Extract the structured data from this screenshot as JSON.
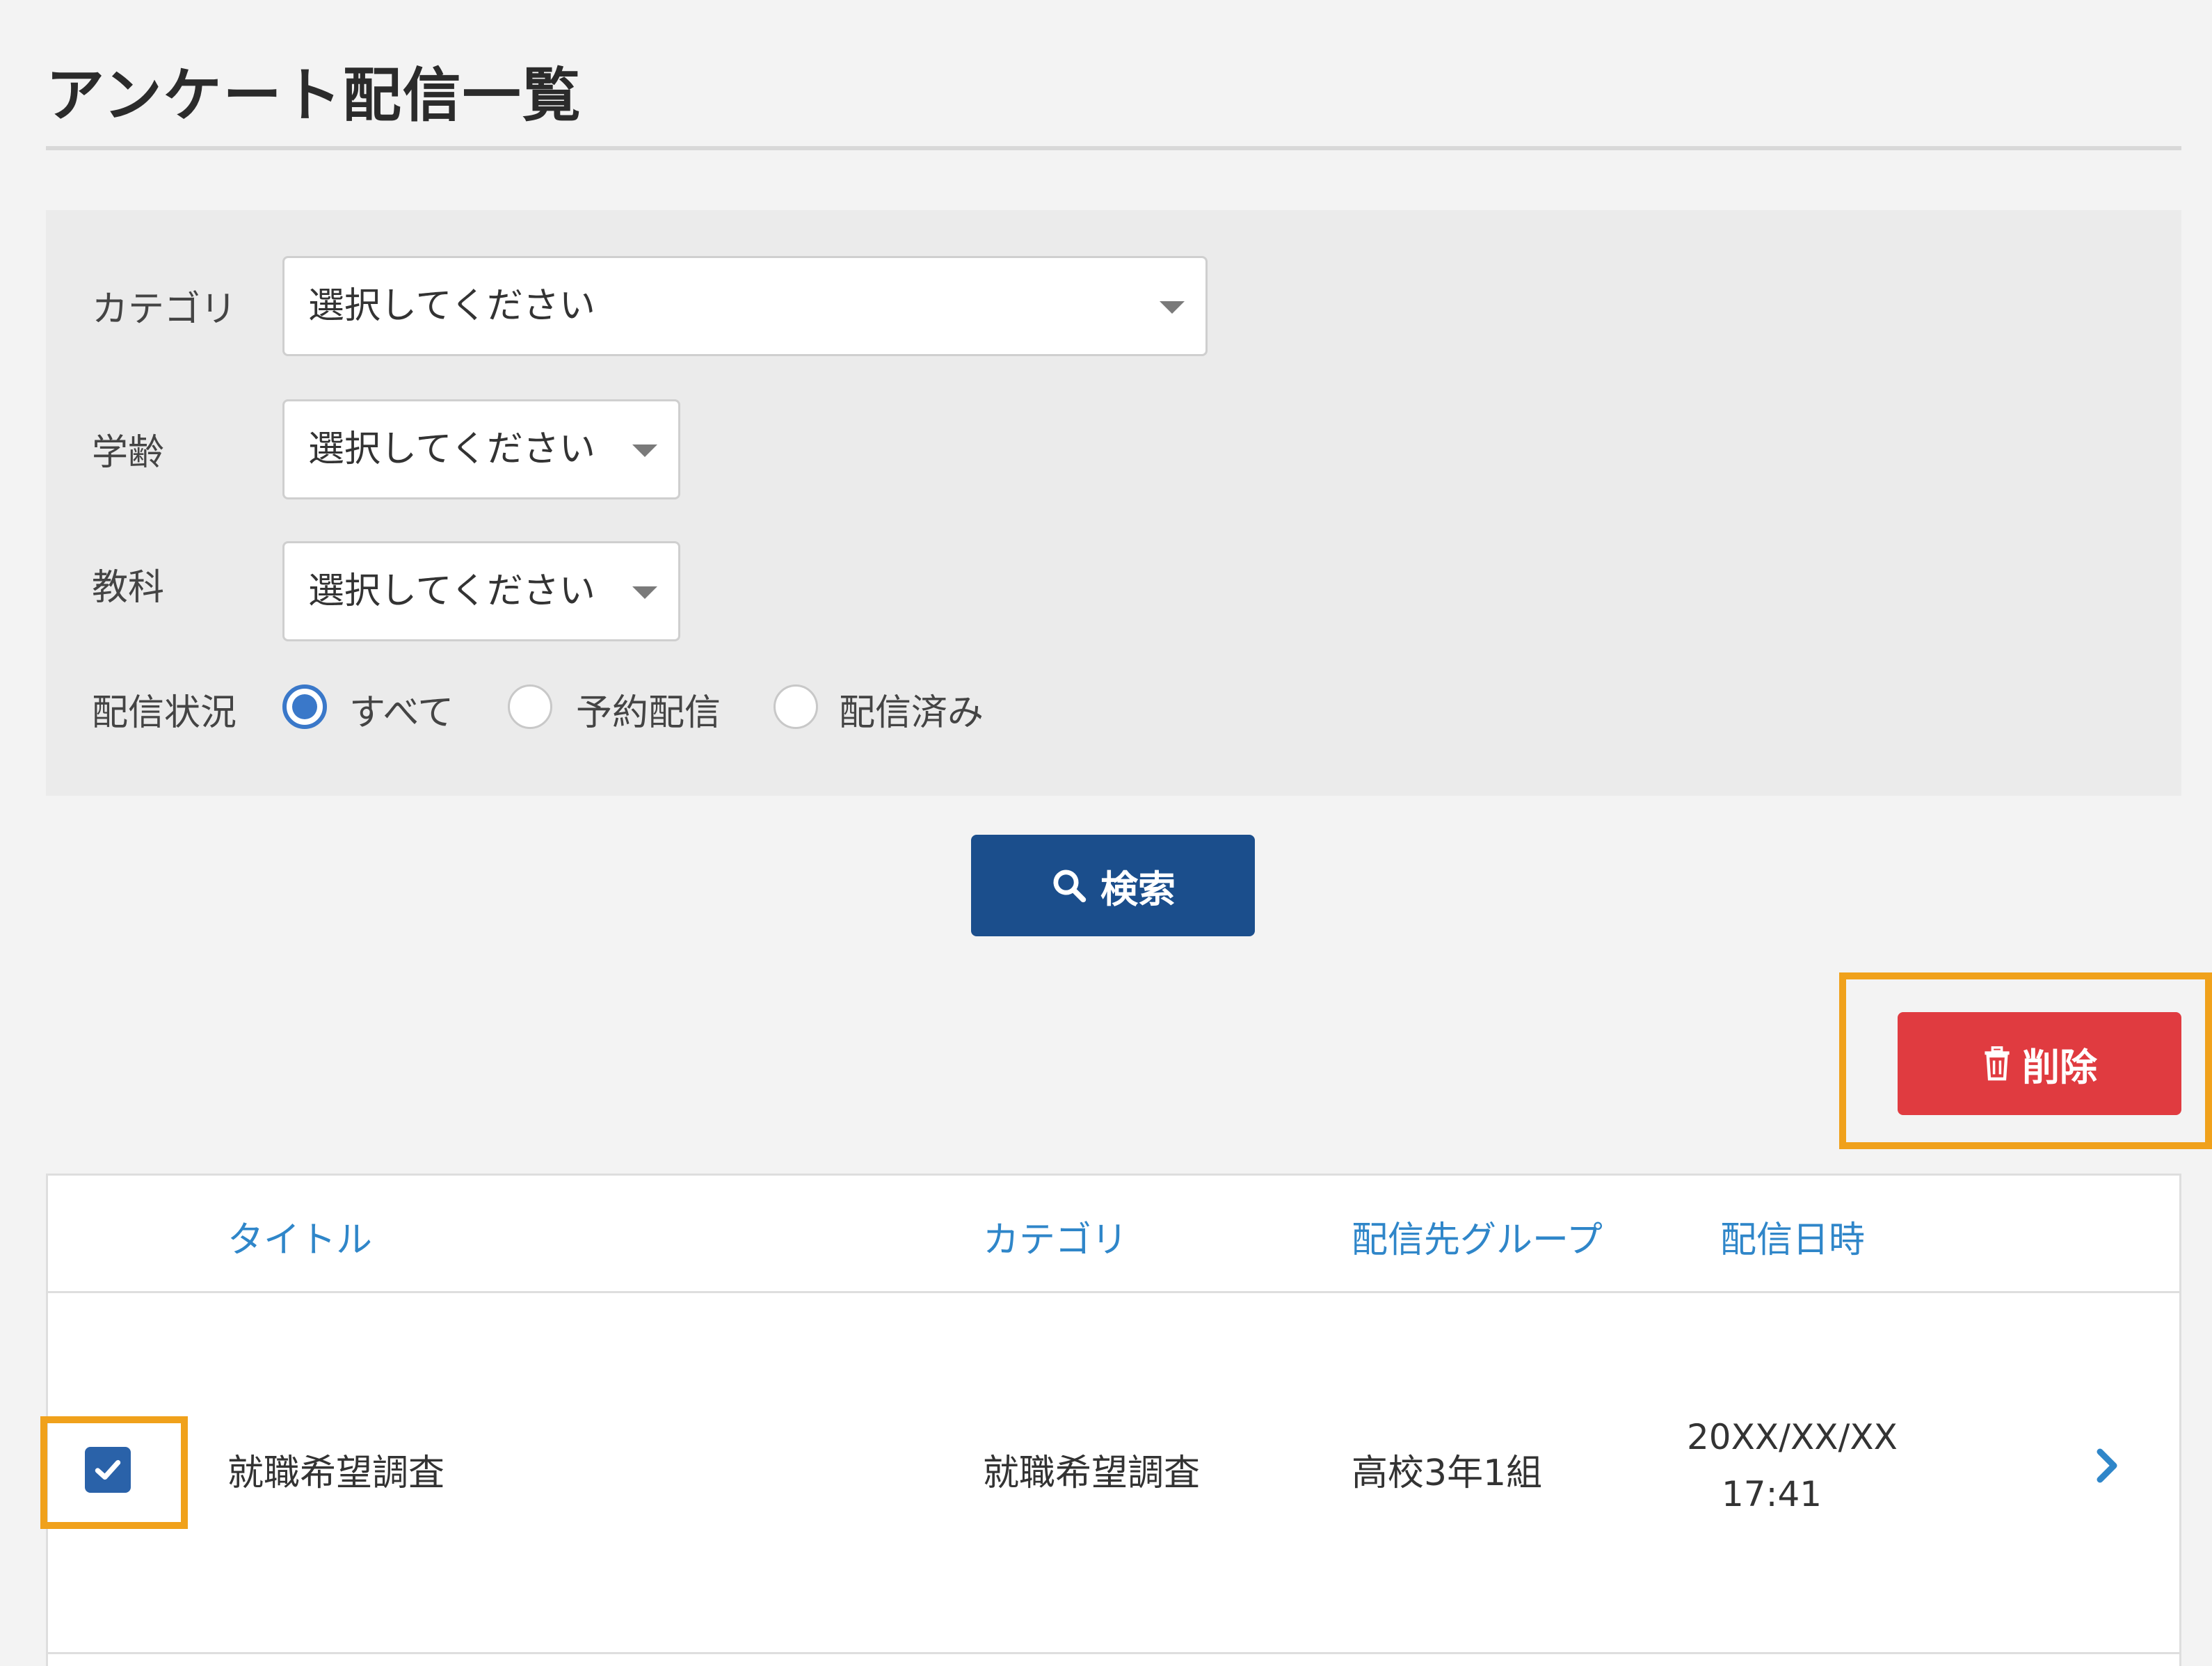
{
  "page": {
    "title": "アンケート配信一覧"
  },
  "filters": {
    "category": {
      "label": "カテゴリ",
      "selected": "選択してください"
    },
    "grade": {
      "label": "学齢",
      "selected": "選択してください"
    },
    "subject": {
      "label": "教科",
      "selected": "選択してください"
    },
    "status": {
      "label": "配信状況",
      "options": [
        {
          "label": "すべて",
          "checked": true
        },
        {
          "label": "予約配信",
          "checked": false
        },
        {
          "label": "配信済み",
          "checked": false
        }
      ]
    }
  },
  "actions": {
    "search_label": "検索",
    "search_icon": "search-icon",
    "delete_label": "削除",
    "delete_icon": "trash-icon"
  },
  "table": {
    "headers": {
      "title": "タイトル",
      "category": "カテゴリ",
      "group": "配信先グループ",
      "datetime": "配信日時"
    },
    "rows": [
      {
        "checked": true,
        "title": "就職希望調査",
        "category": "就職希望調査",
        "group": "高校3年1組",
        "date": "20XX/XX/XX",
        "time": "17:41"
      }
    ]
  },
  "colors": {
    "primary": "#1b4e8c",
    "danger": "#e03b40",
    "link": "#2f86c9",
    "highlight": "#f0a11b",
    "radio_accent": "#3a78c9"
  }
}
